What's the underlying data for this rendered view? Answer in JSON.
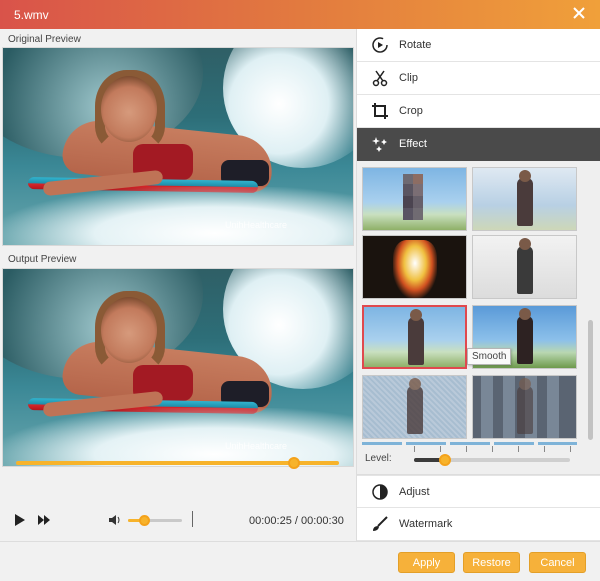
{
  "window": {
    "title": "5.wmv"
  },
  "left": {
    "original_label": "Original Preview",
    "output_label": "Output Preview",
    "watermark_text": "UnihHealthcare"
  },
  "playback": {
    "progress_percent": 86,
    "volume_percent": 30,
    "current_time": "00:00:25",
    "separator": "/",
    "total_time": "00:00:30"
  },
  "menu": {
    "rotate": "Rotate",
    "clip": "Clip",
    "crop": "Crop",
    "effect": "Effect",
    "adjust": "Adjust",
    "watermark": "Watermark"
  },
  "effects": {
    "tooltip": "Smooth",
    "selected_index": 4,
    "thumbnails": [
      "mosaic",
      "sketch-color",
      "neon-glow",
      "pencil-sketch",
      "smooth",
      "sharpen",
      "canvas",
      "tiles"
    ]
  },
  "level": {
    "label": "Level:",
    "value_percent": 20
  },
  "buttons": {
    "apply": "Apply",
    "restore": "Restore",
    "cancel": "Cancel"
  },
  "colors": {
    "accent": "#f7b32b",
    "title_gradient_start": "#d9534a",
    "title_gradient_end": "#f0a03a",
    "selected_border": "#e0494e"
  }
}
